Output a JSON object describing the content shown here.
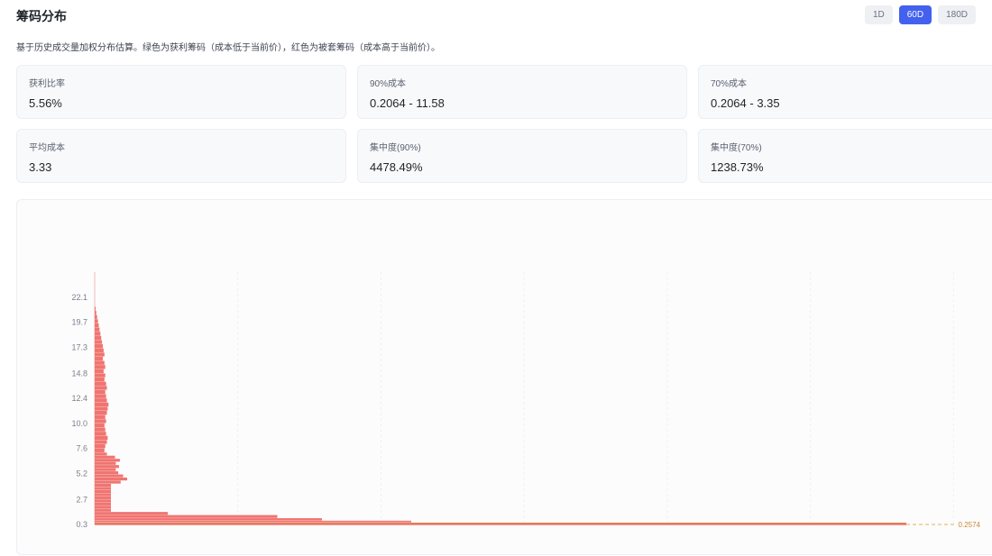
{
  "header": {
    "title": "筹码分布",
    "periods": [
      {
        "label": "1D",
        "active": false
      },
      {
        "label": "60D",
        "active": true
      },
      {
        "label": "180D",
        "active": false
      }
    ]
  },
  "description": "基于历史成交量加权分布估算。绿色为获利筹码（成本低于当前价），红色为被套筹码（成本高于当前价）。",
  "stats": [
    {
      "label": "获利比率",
      "value": "5.56%"
    },
    {
      "label": "90%成本",
      "value": "0.2064 - 11.58"
    },
    {
      "label": "70%成本",
      "value": "0.2064 - 3.35"
    },
    {
      "label": "平均成本",
      "value": "3.33"
    },
    {
      "label": "集中度(90%)",
      "value": "4478.49%"
    },
    {
      "label": "集中度(70%)",
      "value": "1238.73%"
    }
  ],
  "colors": {
    "trapped": "#f07470",
    "profit": "#3fb27f",
    "current_price_line": "#e8b04a",
    "accent": "#4361ee"
  },
  "chart_data": {
    "type": "bar",
    "orientation": "horizontal",
    "y_ticks": [
      "22.1",
      "19.7",
      "17.3",
      "14.8",
      "12.4",
      "10.0",
      "7.6",
      "5.2",
      "2.7",
      "0.3"
    ],
    "ylim": [
      0.3,
      22.1
    ],
    "current_price_label": "0.2574",
    "grid": true,
    "series": [
      {
        "price": [
          0.3,
          0.48,
          0.66,
          0.9,
          1.2,
          1.5,
          1.8,
          2.1,
          2.4,
          2.7,
          3.0,
          3.3,
          3.6,
          3.9,
          4.2,
          4.5,
          4.8,
          5.1,
          5.4,
          5.7,
          6.0,
          6.3,
          6.6,
          6.9,
          7.2,
          7.6,
          8.0,
          8.4,
          8.8,
          9.2,
          9.6,
          10.0,
          10.4,
          10.8,
          11.2,
          11.6,
          12.0,
          12.4,
          12.8,
          13.2,
          13.6,
          14.0,
          14.4,
          14.8,
          15.2,
          15.6,
          16.0,
          16.4,
          16.8,
          17.2,
          17.6,
          18.0,
          18.4,
          18.8,
          19.2,
          19.6,
          20.0,
          20.4,
          20.8
        ],
        "weight": [
          100,
          39,
          28,
          22.5,
          9,
          2,
          2,
          2,
          2,
          2,
          2,
          2,
          2,
          2,
          3.2,
          4,
          3.5,
          2.9,
          2.6,
          3,
          2.6,
          3.1,
          2.5,
          1.5,
          1.2,
          1.3,
          1.5,
          1.6,
          1.4,
          1.3,
          1.2,
          1.4,
          1.3,
          1.5,
          1.6,
          1.7,
          1.5,
          1.4,
          1.3,
          1.5,
          1.4,
          1.2,
          1.3,
          1.1,
          1.3,
          1.2,
          1.0,
          1.2,
          1.1,
          1.0,
          0.9,
          0.8,
          0.7,
          0.6,
          0.5,
          0.4,
          0.3,
          0.2,
          0.1
        ]
      }
    ]
  }
}
